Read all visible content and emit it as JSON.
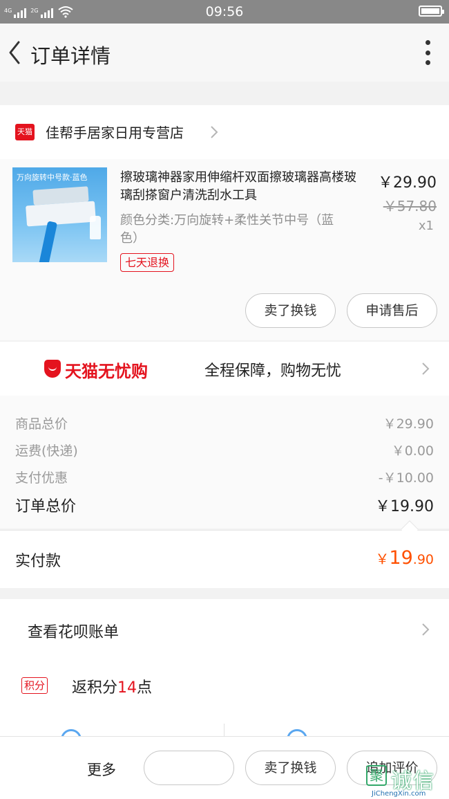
{
  "status_bar": {
    "time": "09:56",
    "signal_1_label": "4G",
    "signal_2_label": "2G"
  },
  "header": {
    "title": "订单详情"
  },
  "shop": {
    "logo_text": "天猫",
    "name": "佳帮手居家日用专营店"
  },
  "product": {
    "image_caption": "万向旋转中号款·蓝色",
    "title": "擦玻璃神器家用伸缩杆双面擦玻璃器高楼玻璃刮搽窗户清洗刮水工具",
    "spec": "颜色分类:万向旋转+柔性关节中号（蓝色）",
    "tag": "七天退换",
    "price": "￥29.90",
    "original_price": "￥57.80",
    "quantity": "x1",
    "buttons": {
      "sell": "卖了换钱",
      "after_sale": "申请售后"
    }
  },
  "worry_free": {
    "brand": "天猫无忧购",
    "slogan": "全程保障，购物无忧"
  },
  "costs": [
    {
      "label": "商品总价",
      "value": "￥29.90"
    },
    {
      "label": "运费(快递)",
      "value": "￥0.00"
    },
    {
      "label": "支付优惠",
      "value": "-￥10.00"
    }
  ],
  "order_total": {
    "label": "订单总价",
    "value": "￥19.90"
  },
  "paid": {
    "label": "实付款",
    "currency": "￥",
    "integer": "19",
    "decimal": ".90"
  },
  "huabei": {
    "label": "查看花呗账单"
  },
  "points": {
    "tag": "积分",
    "prefix": "返积分",
    "amount": "14",
    "suffix": "点"
  },
  "bottom_bar": {
    "more": "更多",
    "blank_button": "",
    "sell": "卖了换钱",
    "review": "追加评价"
  },
  "watermark": {
    "logo": "聚",
    "text": "诚信",
    "url": "JiChengXin.com"
  },
  "colors": {
    "brand_red": "#e4131e",
    "price_orange": "#ff5000",
    "status_bar": "#888888"
  }
}
